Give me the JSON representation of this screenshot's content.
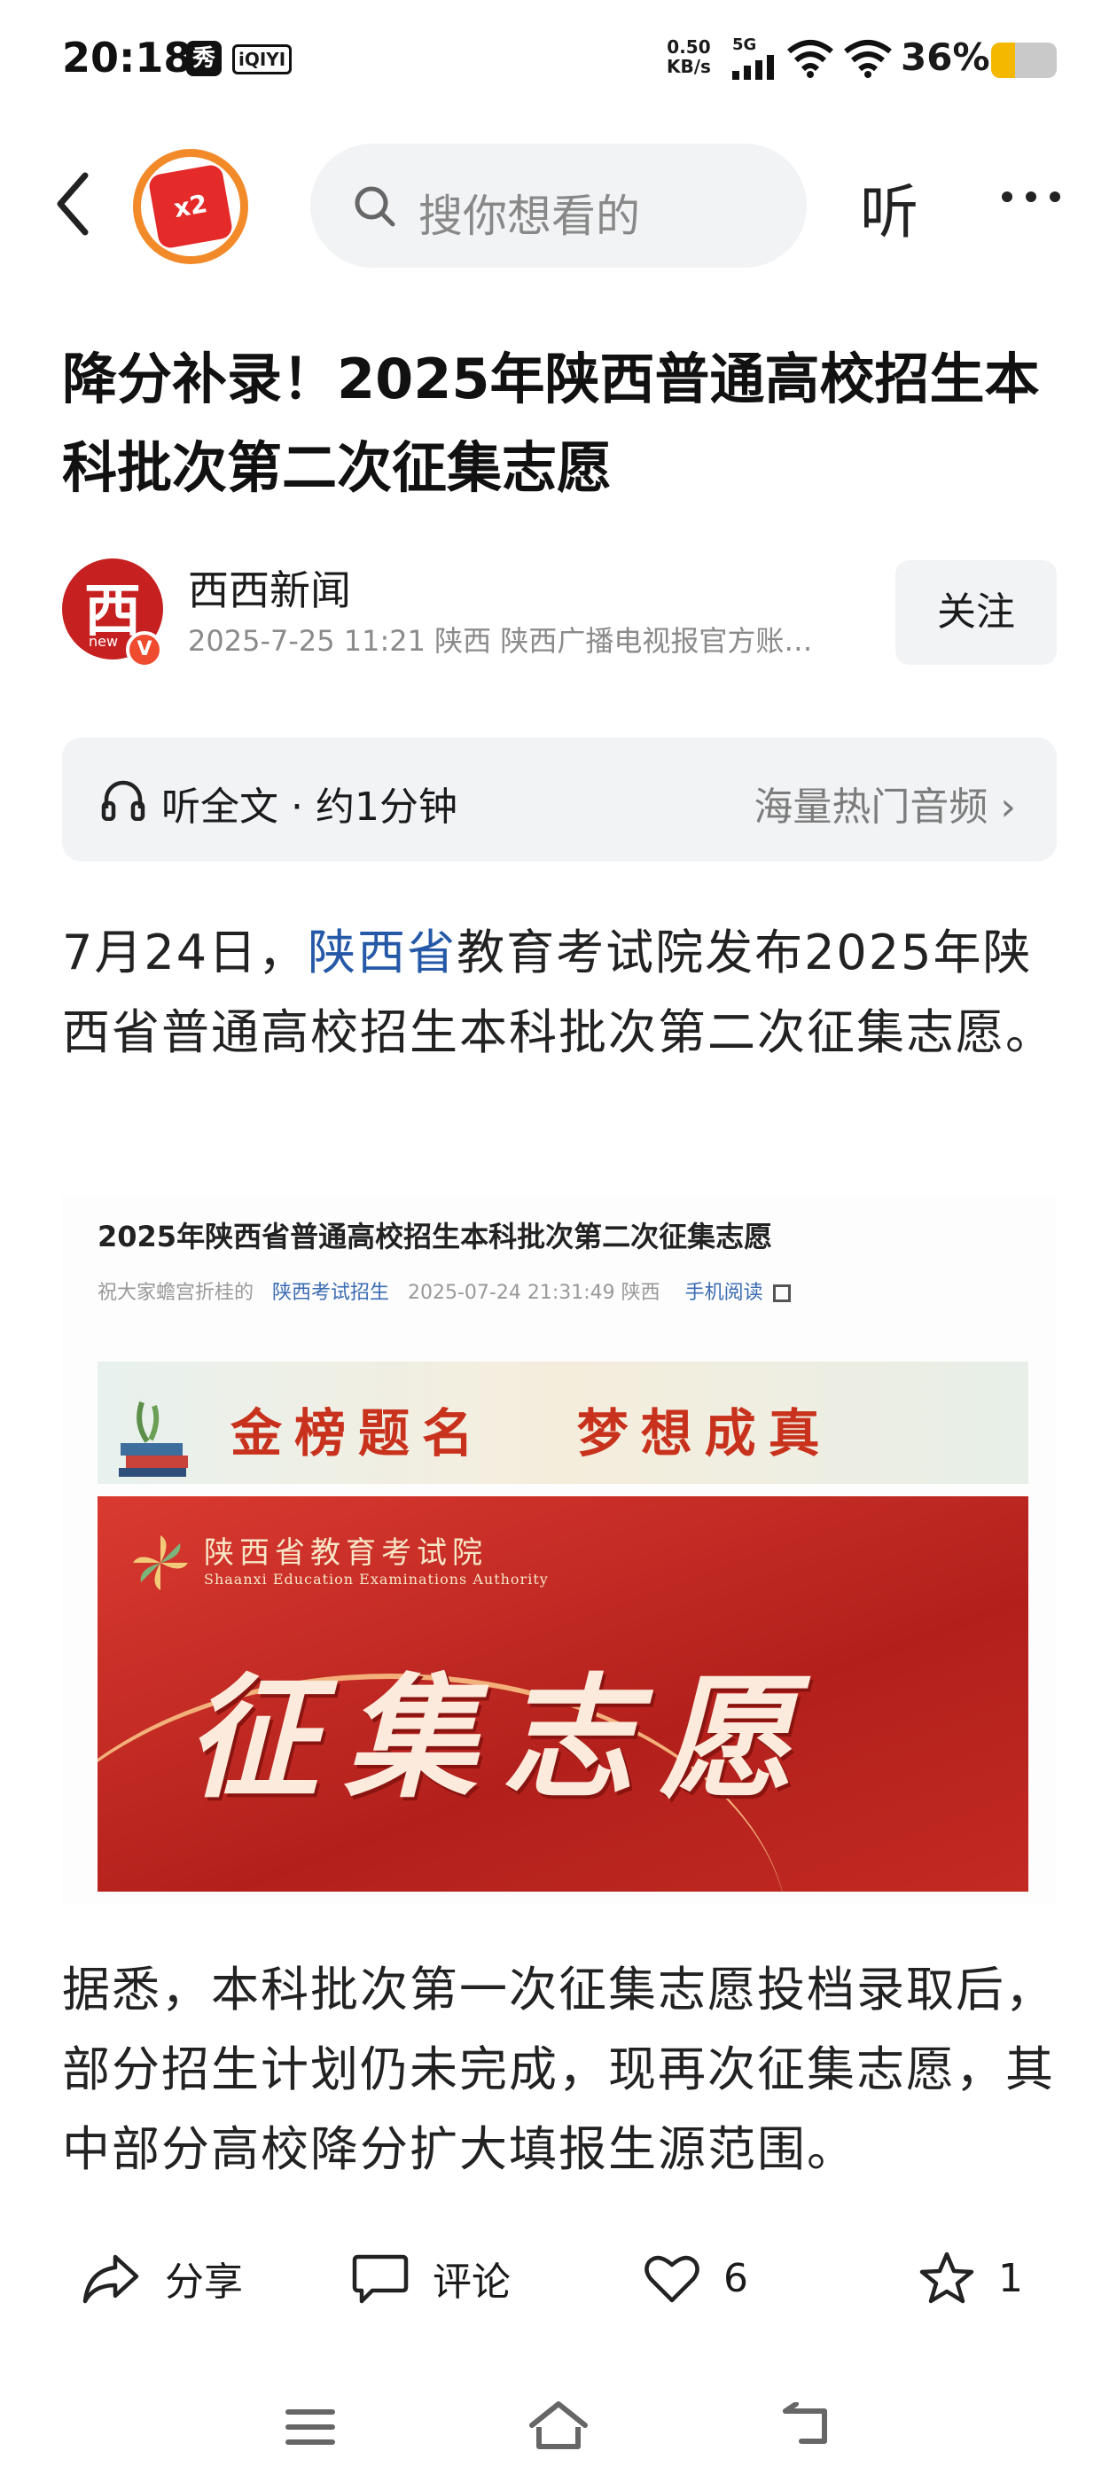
{
  "status_bar": {
    "time": "20:18",
    "app_icon_1": "秀",
    "app_icon_2": "iQIYI",
    "net_speed_value": "0.50",
    "net_speed_unit": "KB/s",
    "network": "5G",
    "battery": "36%",
    "battery_level": 0.36,
    "battery_color": "#f5b800"
  },
  "nav": {
    "badge_text": "x2",
    "search_placeholder": "搜你想看的",
    "listen_label": "听",
    "more_icon": "more-dots-icon"
  },
  "article": {
    "title": "降分补录！2025年陕西普通高校招生本科批次第二次征集志愿",
    "author": {
      "name": "西西新闻",
      "avatar_char": "西",
      "avatar_sub": "new",
      "verified": "V",
      "meta": "2025-7-25  11:21  陕西  陕西广播电视报官方账…",
      "follow_label": "关注"
    },
    "audio": {
      "label": "听全文 · 约1分钟",
      "link": "海量热门音频 ›"
    },
    "para1_before": "7月24日，",
    "para1_link": "陕西省",
    "para1_after": "教育考试院发布2025年陕西省普通高校招生本科批次第二次征集志愿。",
    "embed": {
      "title": "2025年陕西省普通高校招生本科批次第二次征集志愿",
      "meta_prefix": "祝大家蟾宫折桂的",
      "meta_source": "陕西考试招生",
      "meta_time": "2025-07-24 21:31:49 陕西",
      "meta_mobile": "手机阅读",
      "banner_slogan": "金榜题名   梦想成真",
      "org_name": "陕西省教育考试院",
      "org_en": "Shaanxi Education Examinations Authority",
      "banner_big": "征集志愿"
    },
    "para2": "据悉，本科批次第一次征集志愿投档录取后，部分招生计划仍未完成，现再次征集志愿，其中部分高校降分扩大填报生源范围。"
  },
  "actions": {
    "share": "分享",
    "comment": "评论",
    "like_count": "6",
    "favorite_count": "1"
  },
  "colors": {
    "link": "#2559a8",
    "brand_red": "#c62020",
    "badge_ring": "#f28a2a"
  }
}
